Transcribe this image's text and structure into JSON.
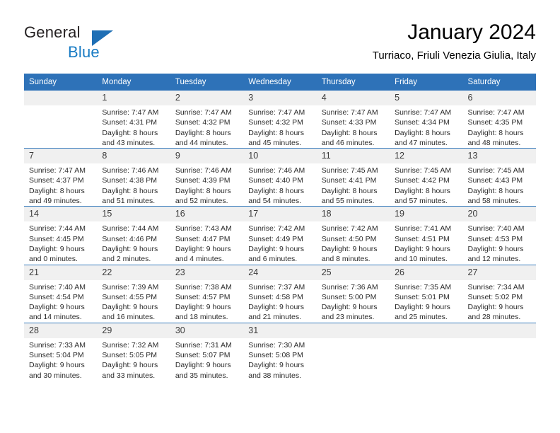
{
  "brand": {
    "name_part1": "General",
    "name_part2": "Blue"
  },
  "header": {
    "month_title": "January 2024",
    "location": "Turriaco, Friuli Venezia Giulia, Italy"
  },
  "colors": {
    "header_blue": "#2e72b8",
    "brand_blue": "#1a7cc4",
    "row_separator": "#3a7dbd",
    "daynum_band": "#f0f0f0"
  },
  "weekdays": [
    "Sunday",
    "Monday",
    "Tuesday",
    "Wednesday",
    "Thursday",
    "Friday",
    "Saturday"
  ],
  "weeks": [
    [
      {
        "day": "",
        "l1": "",
        "l2": "",
        "l3": "",
        "l4": ""
      },
      {
        "day": "1",
        "l1": "Sunrise: 7:47 AM",
        "l2": "Sunset: 4:31 PM",
        "l3": "Daylight: 8 hours",
        "l4": "and 43 minutes."
      },
      {
        "day": "2",
        "l1": "Sunrise: 7:47 AM",
        "l2": "Sunset: 4:32 PM",
        "l3": "Daylight: 8 hours",
        "l4": "and 44 minutes."
      },
      {
        "day": "3",
        "l1": "Sunrise: 7:47 AM",
        "l2": "Sunset: 4:32 PM",
        "l3": "Daylight: 8 hours",
        "l4": "and 45 minutes."
      },
      {
        "day": "4",
        "l1": "Sunrise: 7:47 AM",
        "l2": "Sunset: 4:33 PM",
        "l3": "Daylight: 8 hours",
        "l4": "and 46 minutes."
      },
      {
        "day": "5",
        "l1": "Sunrise: 7:47 AM",
        "l2": "Sunset: 4:34 PM",
        "l3": "Daylight: 8 hours",
        "l4": "and 47 minutes."
      },
      {
        "day": "6",
        "l1": "Sunrise: 7:47 AM",
        "l2": "Sunset: 4:35 PM",
        "l3": "Daylight: 8 hours",
        "l4": "and 48 minutes."
      }
    ],
    [
      {
        "day": "7",
        "l1": "Sunrise: 7:47 AM",
        "l2": "Sunset: 4:37 PM",
        "l3": "Daylight: 8 hours",
        "l4": "and 49 minutes."
      },
      {
        "day": "8",
        "l1": "Sunrise: 7:46 AM",
        "l2": "Sunset: 4:38 PM",
        "l3": "Daylight: 8 hours",
        "l4": "and 51 minutes."
      },
      {
        "day": "9",
        "l1": "Sunrise: 7:46 AM",
        "l2": "Sunset: 4:39 PM",
        "l3": "Daylight: 8 hours",
        "l4": "and 52 minutes."
      },
      {
        "day": "10",
        "l1": "Sunrise: 7:46 AM",
        "l2": "Sunset: 4:40 PM",
        "l3": "Daylight: 8 hours",
        "l4": "and 54 minutes."
      },
      {
        "day": "11",
        "l1": "Sunrise: 7:45 AM",
        "l2": "Sunset: 4:41 PM",
        "l3": "Daylight: 8 hours",
        "l4": "and 55 minutes."
      },
      {
        "day": "12",
        "l1": "Sunrise: 7:45 AM",
        "l2": "Sunset: 4:42 PM",
        "l3": "Daylight: 8 hours",
        "l4": "and 57 minutes."
      },
      {
        "day": "13",
        "l1": "Sunrise: 7:45 AM",
        "l2": "Sunset: 4:43 PM",
        "l3": "Daylight: 8 hours",
        "l4": "and 58 minutes."
      }
    ],
    [
      {
        "day": "14",
        "l1": "Sunrise: 7:44 AM",
        "l2": "Sunset: 4:45 PM",
        "l3": "Daylight: 9 hours",
        "l4": "and 0 minutes."
      },
      {
        "day": "15",
        "l1": "Sunrise: 7:44 AM",
        "l2": "Sunset: 4:46 PM",
        "l3": "Daylight: 9 hours",
        "l4": "and 2 minutes."
      },
      {
        "day": "16",
        "l1": "Sunrise: 7:43 AM",
        "l2": "Sunset: 4:47 PM",
        "l3": "Daylight: 9 hours",
        "l4": "and 4 minutes."
      },
      {
        "day": "17",
        "l1": "Sunrise: 7:42 AM",
        "l2": "Sunset: 4:49 PM",
        "l3": "Daylight: 9 hours",
        "l4": "and 6 minutes."
      },
      {
        "day": "18",
        "l1": "Sunrise: 7:42 AM",
        "l2": "Sunset: 4:50 PM",
        "l3": "Daylight: 9 hours",
        "l4": "and 8 minutes."
      },
      {
        "day": "19",
        "l1": "Sunrise: 7:41 AM",
        "l2": "Sunset: 4:51 PM",
        "l3": "Daylight: 9 hours",
        "l4": "and 10 minutes."
      },
      {
        "day": "20",
        "l1": "Sunrise: 7:40 AM",
        "l2": "Sunset: 4:53 PM",
        "l3": "Daylight: 9 hours",
        "l4": "and 12 minutes."
      }
    ],
    [
      {
        "day": "21",
        "l1": "Sunrise: 7:40 AM",
        "l2": "Sunset: 4:54 PM",
        "l3": "Daylight: 9 hours",
        "l4": "and 14 minutes."
      },
      {
        "day": "22",
        "l1": "Sunrise: 7:39 AM",
        "l2": "Sunset: 4:55 PM",
        "l3": "Daylight: 9 hours",
        "l4": "and 16 minutes."
      },
      {
        "day": "23",
        "l1": "Sunrise: 7:38 AM",
        "l2": "Sunset: 4:57 PM",
        "l3": "Daylight: 9 hours",
        "l4": "and 18 minutes."
      },
      {
        "day": "24",
        "l1": "Sunrise: 7:37 AM",
        "l2": "Sunset: 4:58 PM",
        "l3": "Daylight: 9 hours",
        "l4": "and 21 minutes."
      },
      {
        "day": "25",
        "l1": "Sunrise: 7:36 AM",
        "l2": "Sunset: 5:00 PM",
        "l3": "Daylight: 9 hours",
        "l4": "and 23 minutes."
      },
      {
        "day": "26",
        "l1": "Sunrise: 7:35 AM",
        "l2": "Sunset: 5:01 PM",
        "l3": "Daylight: 9 hours",
        "l4": "and 25 minutes."
      },
      {
        "day": "27",
        "l1": "Sunrise: 7:34 AM",
        "l2": "Sunset: 5:02 PM",
        "l3": "Daylight: 9 hours",
        "l4": "and 28 minutes."
      }
    ],
    [
      {
        "day": "28",
        "l1": "Sunrise: 7:33 AM",
        "l2": "Sunset: 5:04 PM",
        "l3": "Daylight: 9 hours",
        "l4": "and 30 minutes."
      },
      {
        "day": "29",
        "l1": "Sunrise: 7:32 AM",
        "l2": "Sunset: 5:05 PM",
        "l3": "Daylight: 9 hours",
        "l4": "and 33 minutes."
      },
      {
        "day": "30",
        "l1": "Sunrise: 7:31 AM",
        "l2": "Sunset: 5:07 PM",
        "l3": "Daylight: 9 hours",
        "l4": "and 35 minutes."
      },
      {
        "day": "31",
        "l1": "Sunrise: 7:30 AM",
        "l2": "Sunset: 5:08 PM",
        "l3": "Daylight: 9 hours",
        "l4": "and 38 minutes."
      },
      {
        "day": "",
        "l1": "",
        "l2": "",
        "l3": "",
        "l4": ""
      },
      {
        "day": "",
        "l1": "",
        "l2": "",
        "l3": "",
        "l4": ""
      },
      {
        "day": "",
        "l1": "",
        "l2": "",
        "l3": "",
        "l4": ""
      }
    ]
  ]
}
